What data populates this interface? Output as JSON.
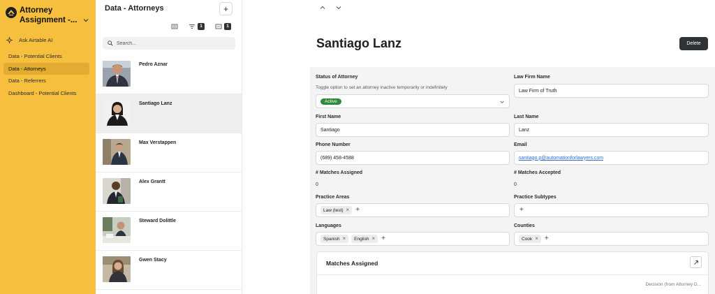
{
  "app": {
    "title": "Attorney Assignment -..."
  },
  "sidebar": {
    "ask_ai": "Ask Airtable AI",
    "items": [
      {
        "label": "Data - Potential Clients",
        "active": false
      },
      {
        "label": "Data - Attorneys",
        "active": true
      },
      {
        "label": "Data - Referrers",
        "active": false
      },
      {
        "label": "Dashboard - Potential Clients",
        "active": false
      }
    ]
  },
  "list": {
    "title": "Data - Attorneys",
    "add_label": "+",
    "filter_count": "1",
    "group_count": "1",
    "search_placeholder": "Search...",
    "records": [
      {
        "name": "Pedro Aznar",
        "selected": false
      },
      {
        "name": "Santiago Lanz",
        "selected": true
      },
      {
        "name": "Max Verstappen",
        "selected": false
      },
      {
        "name": "Alex Grantt",
        "selected": false
      },
      {
        "name": "Steward Dolittle",
        "selected": false
      },
      {
        "name": "Gwen Stacy",
        "selected": false
      }
    ]
  },
  "detail": {
    "title": "Santiago Lanz",
    "delete_label": "Delete",
    "status": {
      "label": "Status of Attorney",
      "description": "Toggle option to set an attorney inactive temporarily or indefinitely",
      "value": "Active"
    },
    "law_firm": {
      "label": "Law Firm Name",
      "value": "Law Firm of Truth"
    },
    "first_name": {
      "label": "First Name",
      "value": "Santiago"
    },
    "last_name": {
      "label": "Last Name",
      "value": "Lanz"
    },
    "phone": {
      "label": "Phone Number",
      "value": "(689) 458-4588"
    },
    "email": {
      "label": "Email",
      "value": "santiago.p@automationforlawyers.com"
    },
    "matches_assigned": {
      "label": "# Matches Assigned",
      "value": "0"
    },
    "matches_accepted": {
      "label": "# Matches Accepted",
      "value": "0"
    },
    "practice_areas": {
      "label": "Practice Areas",
      "chips": [
        "Law (test)"
      ]
    },
    "practice_subtypes": {
      "label": "Practice Subtypes",
      "chips": []
    },
    "languages": {
      "label": "Languages",
      "chips": [
        "Spanish",
        "English"
      ]
    },
    "counties": {
      "label": "Counties",
      "chips": [
        "Cook"
      ]
    },
    "matches_card": {
      "title": "Matches Assigned",
      "column": "Decision (from Attorney D..."
    }
  },
  "colors": {
    "sidebar": "#f6bf3e",
    "sidebar_active": "#e3ab2f",
    "status_active": "#2f8a3c",
    "delete_button": "#303336"
  },
  "icons": [
    "app-logo-icon",
    "chevron-down-icon",
    "sparkle-icon",
    "plus-icon",
    "layout-icon",
    "filter-icon",
    "group-icon",
    "search-icon",
    "arrow-up-icon",
    "arrow-down-icon",
    "remove-x-icon",
    "expand-icon"
  ]
}
